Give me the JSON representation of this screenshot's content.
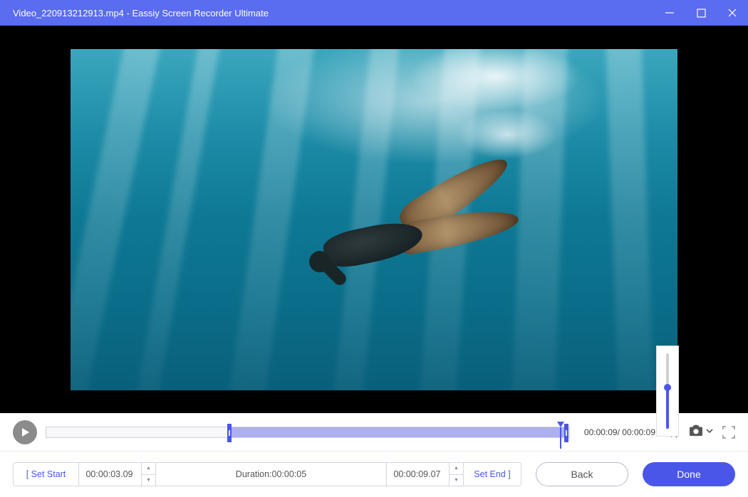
{
  "titlebar": {
    "filename": "Video_220913212913.mp4",
    "separator": "  -  ",
    "app_name": "Eassiy Screen Recorder Ultimate"
  },
  "playbar": {
    "current_time": "00:00:09",
    "total_time": "00:00:09"
  },
  "clip": {
    "set_start_label": "[ Set Start",
    "start_time": "00:00:03.09",
    "duration_label": "Duration:",
    "duration_value": "00:00:05",
    "end_time": "00:00:09.07",
    "set_end_label": "Set End ]"
  },
  "buttons": {
    "back": "Back",
    "done": "Done"
  },
  "volume": {
    "level_percent": 55
  },
  "icons": {
    "minimize": "minimize",
    "maximize": "maximize",
    "close": "close",
    "play": "play",
    "volume": "volume",
    "camera": "camera",
    "chevron_down": "chevron-down",
    "fullscreen": "fullscreen"
  }
}
